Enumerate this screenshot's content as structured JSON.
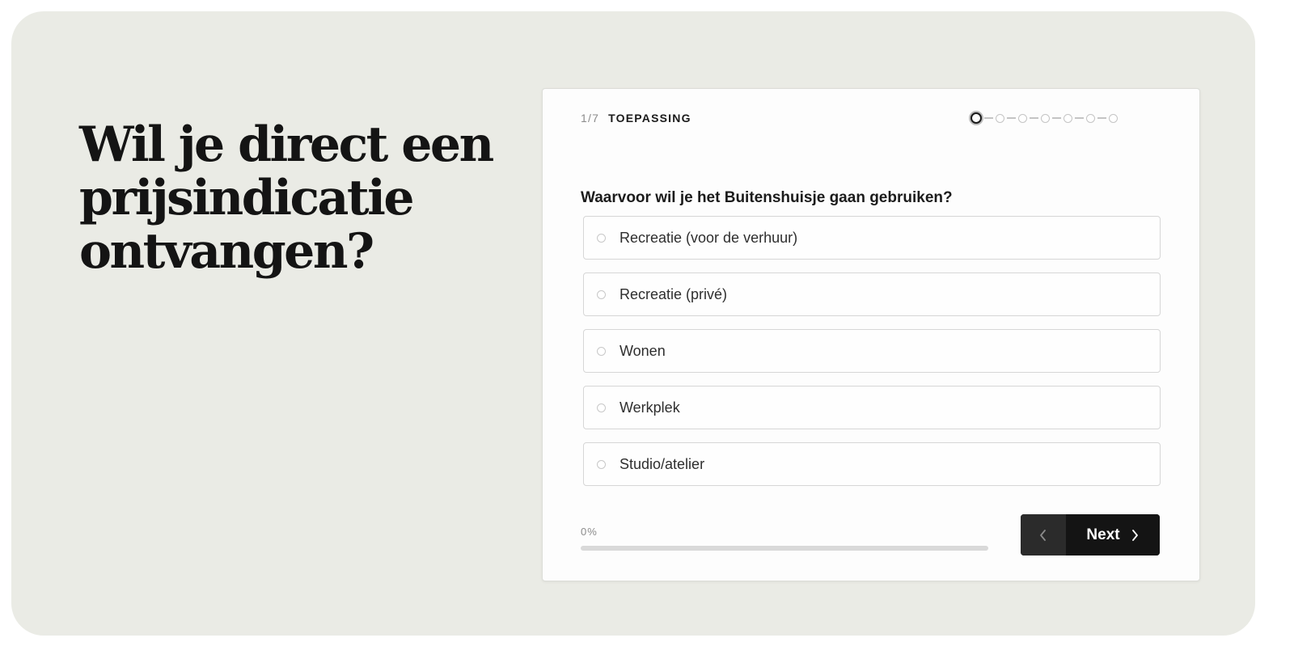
{
  "headline": "Wil je direct een prijsindicatie ontvangen?",
  "form": {
    "step": {
      "count": "1/7",
      "title": "TOEPASSING",
      "current": 1,
      "total": 7
    },
    "question": "Waarvoor wil je het Buitenshuisje gaan gebruiken?",
    "options": [
      {
        "label": "Recreatie (voor de verhuur)",
        "selected": false
      },
      {
        "label": "Recreatie (privé)",
        "selected": false
      },
      {
        "label": "Wonen",
        "selected": false
      },
      {
        "label": "Werkplek",
        "selected": false
      },
      {
        "label": "Studio/atelier",
        "selected": false
      }
    ],
    "progress": {
      "text": "0%",
      "value": 0
    },
    "nav": {
      "prev_icon": "chevron-left-icon",
      "next_label": "Next",
      "next_icon": "chevron-right-icon"
    }
  },
  "colors": {
    "background_panel": "#eaebe5",
    "button_dark": "#141414",
    "text_dark": "#1b1b1b"
  }
}
